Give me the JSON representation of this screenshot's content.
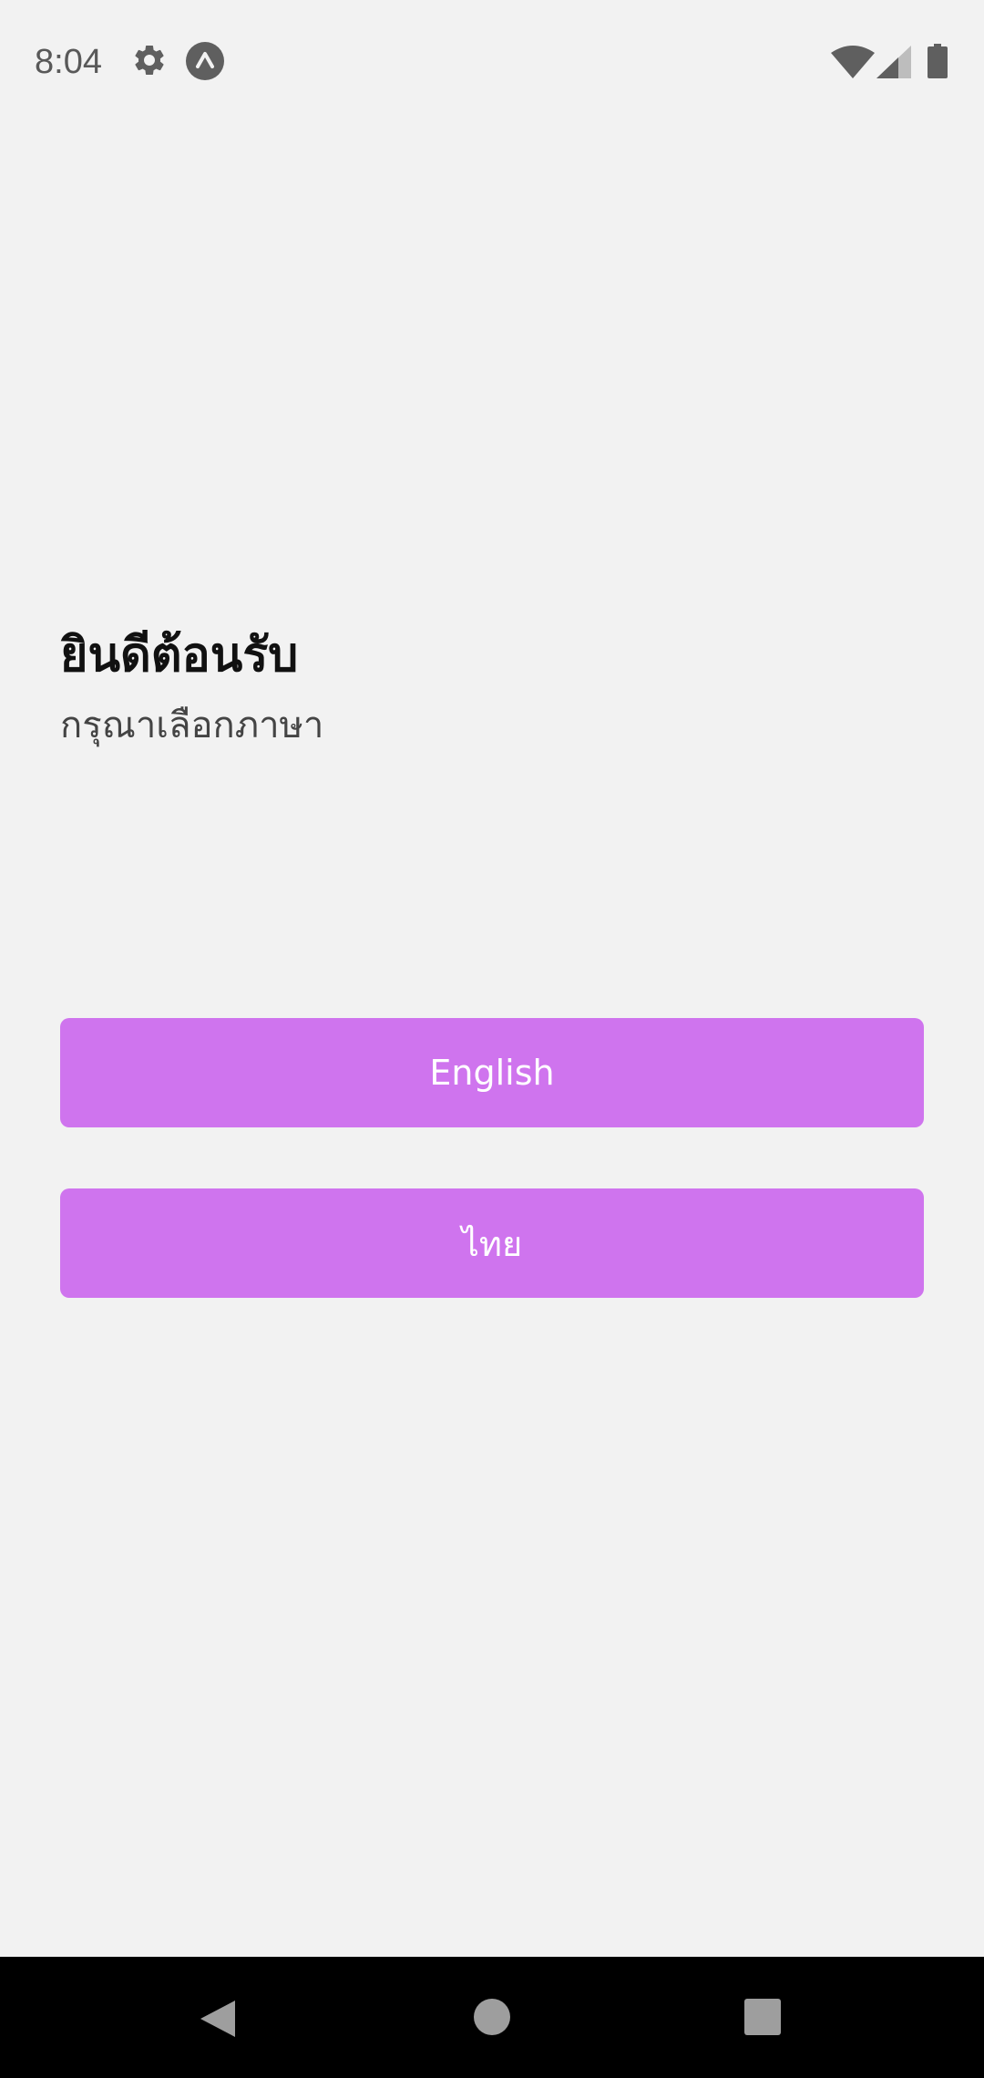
{
  "status_bar": {
    "time": "8:04",
    "icons": [
      "gear-icon",
      "accessibility-icon",
      "wifi-icon",
      "cell-signal-icon",
      "battery-icon"
    ]
  },
  "welcome": {
    "title": "ยินดีต้อนรับ",
    "subtitle": "กรุณาเลือกภาษา"
  },
  "language_buttons": {
    "english_label": "English",
    "thai_label": "ไทย"
  },
  "colors": {
    "background": "#f2f2f2",
    "button": "#cf74ee",
    "button_text": "#ffffff",
    "nav_bar": "#000000"
  },
  "nav_bar": {
    "icons": [
      "back-icon",
      "home-icon",
      "recents-icon"
    ]
  }
}
